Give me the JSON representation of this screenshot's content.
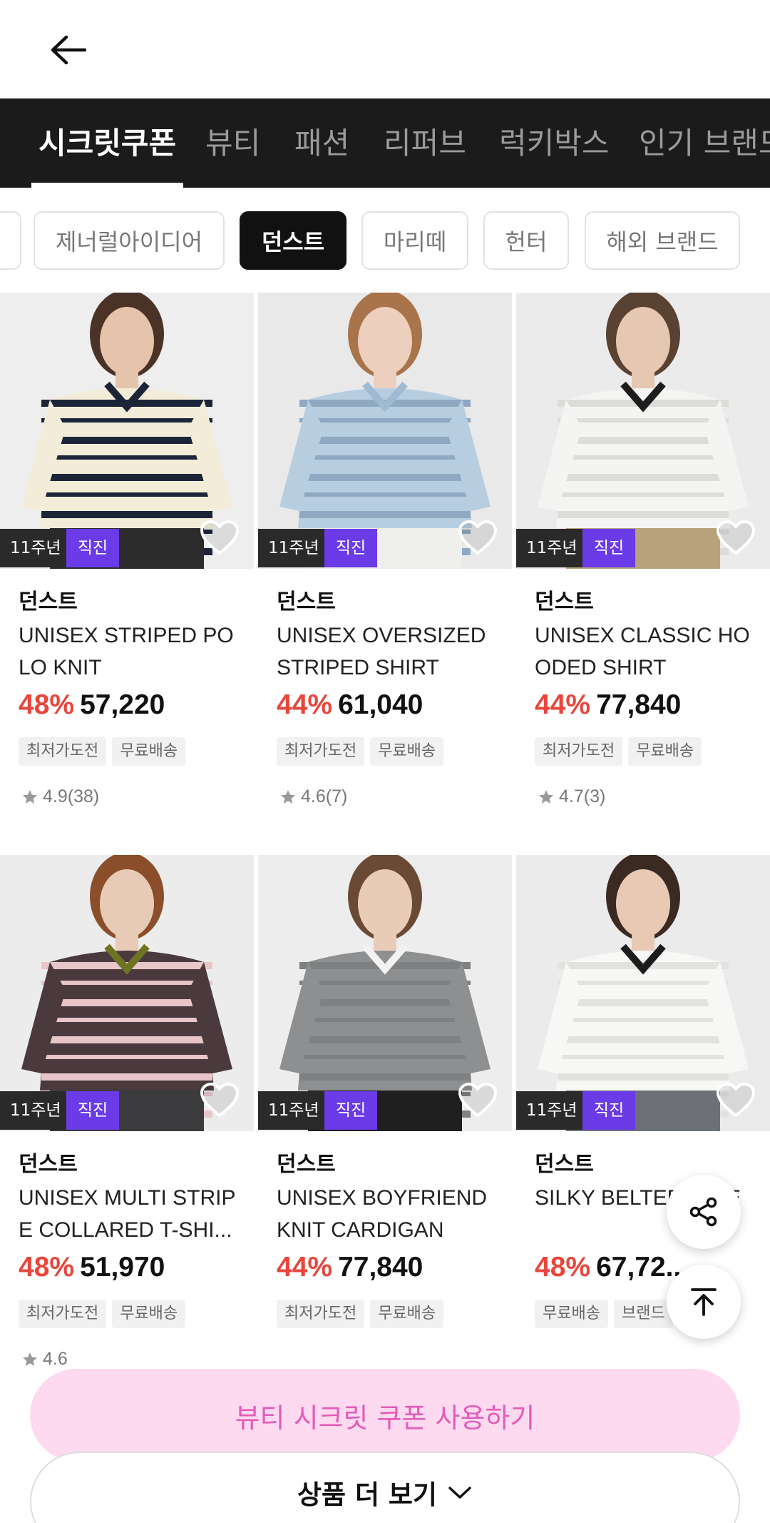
{
  "header": {
    "back_icon": "arrow-left-icon"
  },
  "category_tabs": [
    {
      "label": "시크릿쿠폰",
      "active": true
    },
    {
      "label": "뷰티",
      "active": false
    },
    {
      "label": "패션",
      "active": false
    },
    {
      "label": "리퍼브",
      "active": false
    },
    {
      "label": "럭키박스",
      "active": false
    },
    {
      "label": "인기 브랜드",
      "active": false
    }
  ],
  "brand_chips": [
    {
      "label": "",
      "active": false
    },
    {
      "label": "제너럴아이디어",
      "active": false
    },
    {
      "label": "던스트",
      "active": true
    },
    {
      "label": "마리떼",
      "active": false
    },
    {
      "label": "헌터",
      "active": false
    },
    {
      "label": "해외 브랜드",
      "active": false
    }
  ],
  "products": [
    {
      "badge_years": "11주년",
      "badge_direct": "직진",
      "brand": "던스트",
      "name": "UNISEX STRIPED PO LO KNIT",
      "discount": "48%",
      "price": "57,220",
      "tags": [
        "최저가도전",
        "무료배송"
      ],
      "rating": "4.9(38)",
      "colors": {
        "bg": "#eeeeee",
        "top": "#f3ecd9",
        "stripe": "#1c2538",
        "skin": "#e6c3ab",
        "hair": "#4a3326",
        "bottom": "#2b2b2b",
        "accent": "#1c2538"
      }
    },
    {
      "badge_years": "11주년",
      "badge_direct": "직진",
      "brand": "던스트",
      "name": "UNISEX OVERSIZED STRIPED SHIRT",
      "discount": "44%",
      "price": "61,040",
      "tags": [
        "최저가도전",
        "무료배송"
      ],
      "rating": "4.6(7)",
      "colors": {
        "bg": "#e9e9e9",
        "top": "#b7cde0",
        "stripe": "#8fa9c2",
        "skin": "#ecd0bd",
        "hair": "#a9744a",
        "bottom": "#efefec",
        "accent": "#9fbbd3"
      }
    },
    {
      "badge_years": "11주년",
      "badge_direct": "직진",
      "brand": "던스트",
      "name": "UNISEX CLASSIC HO ODED SHIRT",
      "discount": "44%",
      "price": "77,840",
      "tags": [
        "최저가도전",
        "무료배송"
      ],
      "rating": "4.7(3)",
      "colors": {
        "bg": "#ebebeb",
        "top": "#f4f4f2",
        "stripe": "#dcdcd8",
        "skin": "#e5c7b2",
        "hair": "#5a4232",
        "bottom": "#b7a27c",
        "accent": "#1d1d1d"
      }
    },
    {
      "badge_years": "11주년",
      "badge_direct": "직진",
      "brand": "던스트",
      "name": "UNISEX MULTI STRIP E COLLARED T-SHI...",
      "discount": "48%",
      "price": "51,970",
      "tags": [
        "최저가도전",
        "무료배송"
      ],
      "rating": "4.6",
      "colors": {
        "bg": "#ececec",
        "top": "#4a3a3e",
        "stripe": "#e7c5c9",
        "skin": "#e8cbb7",
        "hair": "#8a4e2a",
        "bottom": "#3b3b3e",
        "accent": "#6f7424"
      }
    },
    {
      "badge_years": "11주년",
      "badge_direct": "직진",
      "brand": "던스트",
      "name": "UNISEX BOYFRIEND KNIT CARDIGAN",
      "discount": "44%",
      "price": "77,840",
      "tags": [
        "최저가도전",
        "무료배송"
      ],
      "rating": "",
      "colors": {
        "bg": "#ededed",
        "top": "#8d8f90",
        "stripe": "#7e8081",
        "skin": "#e9ccb8",
        "hair": "#6b4a35",
        "bottom": "#1f1f1f",
        "accent": "#f2f2f2"
      }
    },
    {
      "badge_years": "11주년",
      "badge_direct": "직진",
      "brand": "던스트",
      "name": "SILKY BELTED ... SE",
      "discount": "48%",
      "price": "67,72...",
      "tags": [
        "무료배송",
        "브랜드"
      ],
      "rating": "",
      "colors": {
        "bg": "#ebebeb",
        "top": "#f7f7f5",
        "stripe": "#e2e2df",
        "skin": "#e7c9b4",
        "hair": "#3b2a22",
        "bottom": "#6d7177",
        "accent": "#1c1c1c"
      }
    }
  ],
  "fabs": {
    "share_icon": "share-icon",
    "top_icon": "scroll-top-icon"
  },
  "coupon_button": {
    "label": "뷰티 시크릿 쿠폰 사용하기"
  },
  "more_button": {
    "label": "상품 더 보기",
    "icon": "chevron-down-icon"
  }
}
